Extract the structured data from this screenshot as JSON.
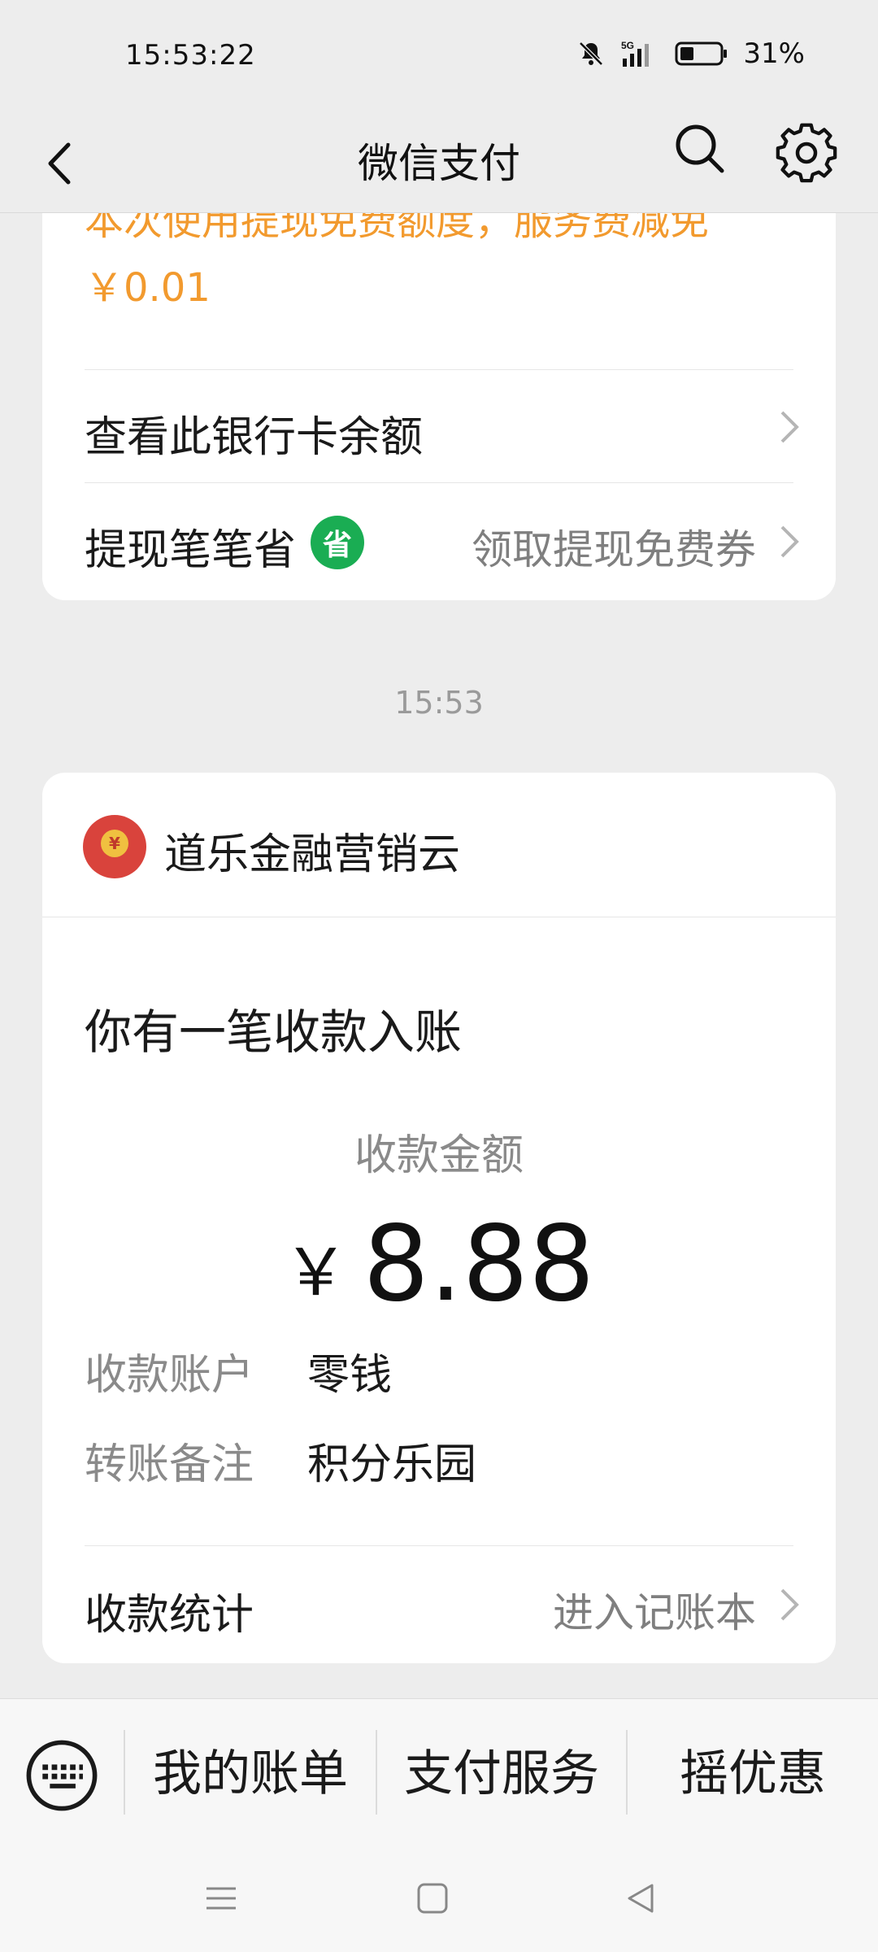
{
  "status": {
    "time": "15:53:22",
    "network": "5G",
    "battery": "31%"
  },
  "header": {
    "title": "微信支付"
  },
  "top_card": {
    "fee_text_line1": "本次使用提现免费额度，服务费减免",
    "fee_text_line2": "￥0.01",
    "rows": [
      {
        "label": "查看此银行卡余额",
        "right": ""
      },
      {
        "label": "提现笔笔省",
        "badge": "省",
        "right": "领取提现免费券"
      }
    ]
  },
  "timestamp": "15:53",
  "main_card": {
    "merchant": "道乐金融营销云",
    "headline": "你有一笔收款入账",
    "amount_label": "收款金额",
    "currency": "￥",
    "amount": "8.88",
    "details": [
      {
        "label": "收款账户",
        "value": "零钱"
      },
      {
        "label": "转账备注",
        "value": "积分乐园"
      }
    ],
    "stats_label": "收款统计",
    "stats_link": "进入记账本"
  },
  "bottom_menu": {
    "items": [
      "我的账单",
      "支付服务",
      "摇优惠"
    ]
  },
  "colors": {
    "orange": "#f29a2e",
    "green": "#1aad53",
    "red": "#d9433c"
  }
}
